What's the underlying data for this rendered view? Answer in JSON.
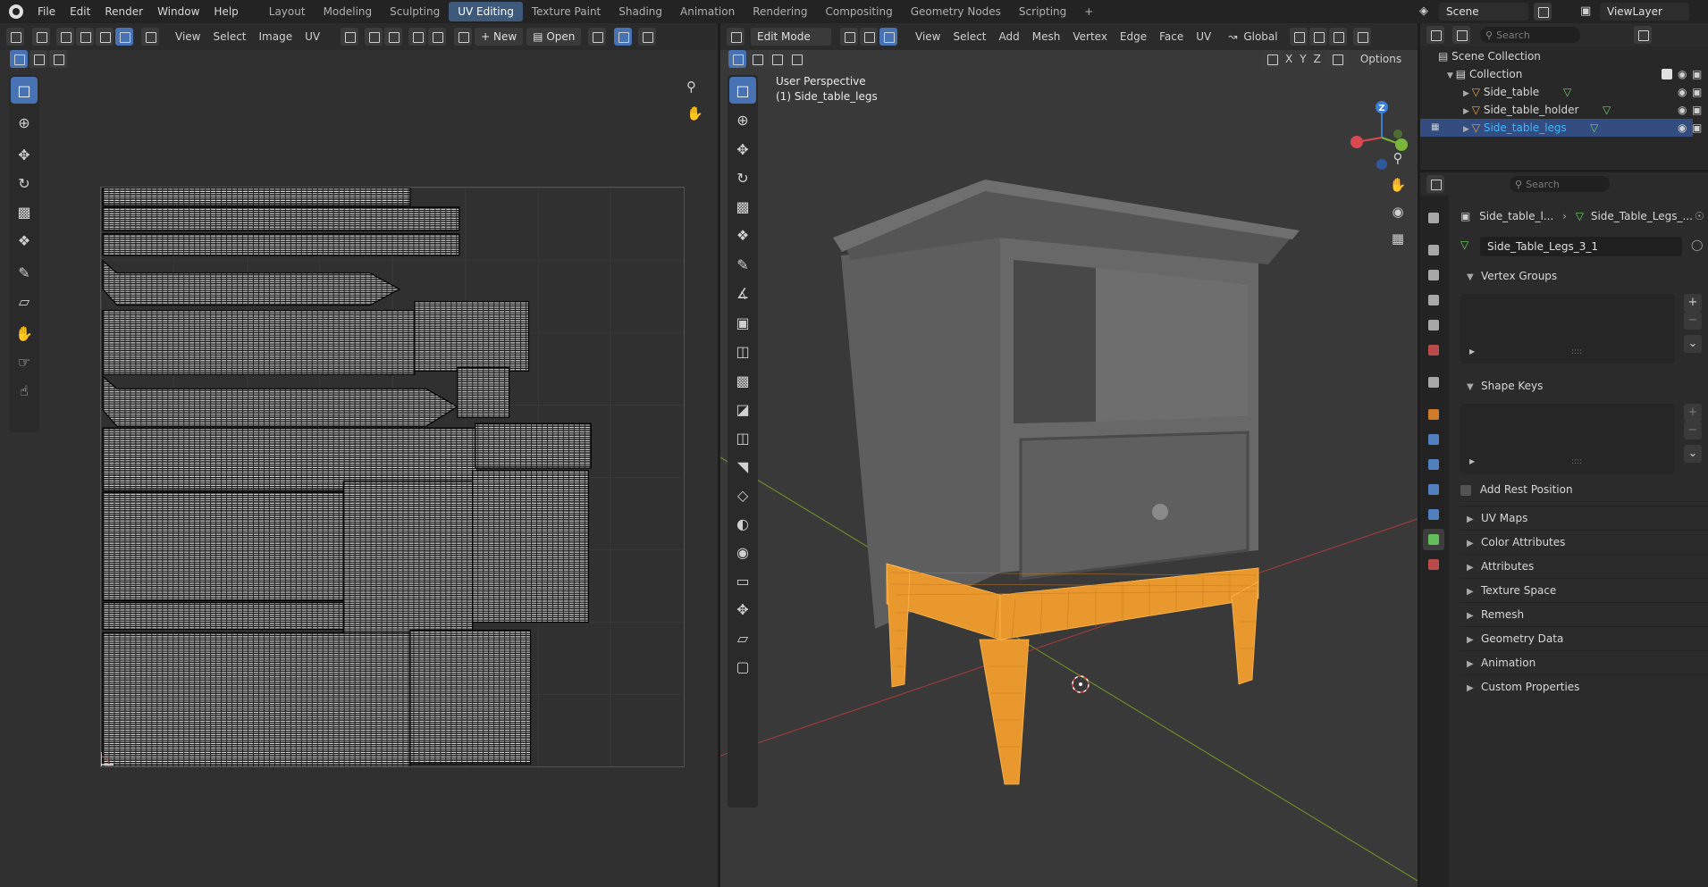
{
  "topbar": {
    "menus": [
      "File",
      "Edit",
      "Render",
      "Window",
      "Help"
    ],
    "workspaces": [
      "Layout",
      "Modeling",
      "Sculpting",
      "UV Editing",
      "Texture Paint",
      "Shading",
      "Animation",
      "Rendering",
      "Compositing",
      "Geometry Nodes",
      "Scripting"
    ],
    "active_workspace": "UV Editing",
    "add_tab": "+",
    "scene": "Scene",
    "view_layer": "ViewLayer"
  },
  "uv_editor": {
    "menus": [
      "View",
      "Select",
      "Image",
      "UV"
    ],
    "new_label": "New",
    "open_label": "Open"
  },
  "viewport": {
    "mode": "Edit Mode",
    "menus": [
      "View",
      "Select",
      "Add",
      "Mesh",
      "Vertex",
      "Edge",
      "Face",
      "UV"
    ],
    "orientation": "Global",
    "axis_x": "X",
    "axis_y": "Y",
    "axis_z": "Z",
    "options_label": "Options",
    "perspective_label": "User Perspective",
    "object_label": "(1) Side_table_legs",
    "gizmo_z": "Z",
    "colors": {
      "selected_object": "#f0a33a",
      "x_axis": "#9a3a3a",
      "y_axis": "#6a8a2a",
      "gizmo_x": "#d9494f",
      "gizmo_y": "#7bb53b",
      "gizmo_z": "#3c7fd8"
    }
  },
  "outliner": {
    "search_placeholder": "Search",
    "scene_collection": "Scene Collection",
    "collection": "Collection",
    "items": [
      {
        "label": "Side_table"
      },
      {
        "label": "Side_table_holder"
      },
      {
        "label": "Side_table_legs"
      }
    ]
  },
  "properties": {
    "search_placeholder": "Search",
    "breadcrumb_object": "Side_table_l...",
    "breadcrumb_mesh": "Side_Table_Legs_...",
    "mesh_name": "Side_Table_Legs_3_1",
    "vertex_groups": "Vertex Groups",
    "shape_keys": "Shape Keys",
    "add_rest_position": "Add Rest Position",
    "sections": [
      "UV Maps",
      "Color Attributes",
      "Attributes",
      "Texture Space",
      "Remesh",
      "Geometry Data",
      "Animation",
      "Custom Properties"
    ]
  }
}
